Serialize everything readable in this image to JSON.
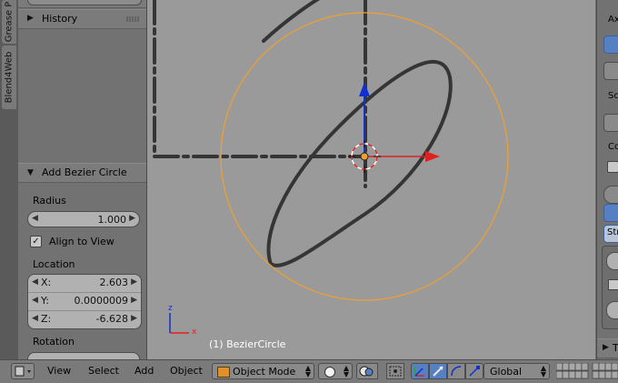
{
  "side_tabs": [
    "Grease P",
    "Blend4Web"
  ],
  "history_panel": {
    "title": "History"
  },
  "operator_panel": {
    "title": "Add Bezier Circle",
    "radius_label": "Radius",
    "radius_value": "1.000",
    "align_to_view_label": "Align to View",
    "align_to_view_checked": true,
    "location_label": "Location",
    "location": [
      {
        "axis": "X:",
        "value": "2.603"
      },
      {
        "axis": "Y:",
        "value": "0.0000009"
      },
      {
        "axis": "Z:",
        "value": "-6.628"
      }
    ],
    "rotation_label": "Rotation"
  },
  "viewport": {
    "object_status": "(1) BezierCircle",
    "axis_labels": {
      "z": "z",
      "x": "x"
    }
  },
  "right_panel": {
    "labels": [
      "Ax",
      "Sc",
      "Co",
      "Str",
      "T"
    ]
  },
  "header": {
    "menus": [
      "View",
      "Select",
      "Add",
      "Object"
    ],
    "mode": "Object Mode",
    "orientation": "Global"
  },
  "colors": {
    "selection_circle": "#f0a030",
    "x_axis": "#e02020",
    "z_axis": "#1030d0",
    "active_button": "#5680c2"
  }
}
